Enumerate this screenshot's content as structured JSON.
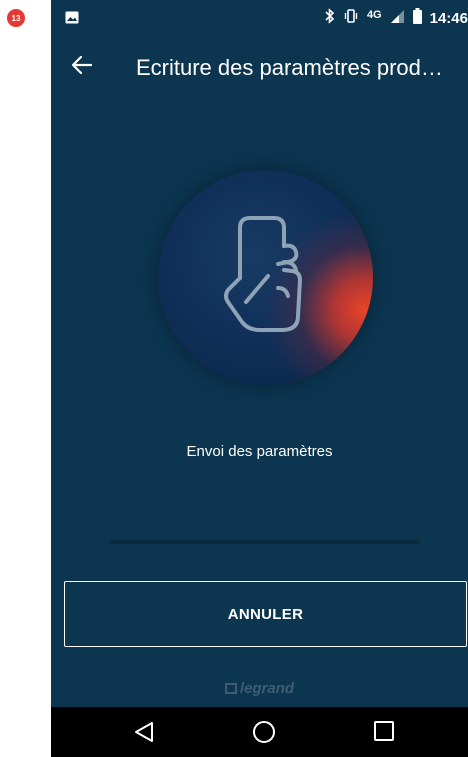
{
  "annotation": {
    "step_number": "13"
  },
  "status_bar": {
    "network": "4G",
    "time": "14:46"
  },
  "app_bar": {
    "title": "Ecriture des paramètres prod…"
  },
  "main": {
    "status_text": "Envoi des paramètres",
    "progress": 0.0,
    "cancel_label": "ANNULER"
  },
  "footer": {
    "brand": "legrand"
  },
  "colors": {
    "background": "#0c3550",
    "accent": "#e84428",
    "text": "#ffffff"
  },
  "icons": {
    "back": "arrow-left-icon",
    "illustration": "hand-holding-phone-icon",
    "nav": [
      "back-triangle-icon",
      "home-circle-icon",
      "recents-square-icon"
    ]
  }
}
